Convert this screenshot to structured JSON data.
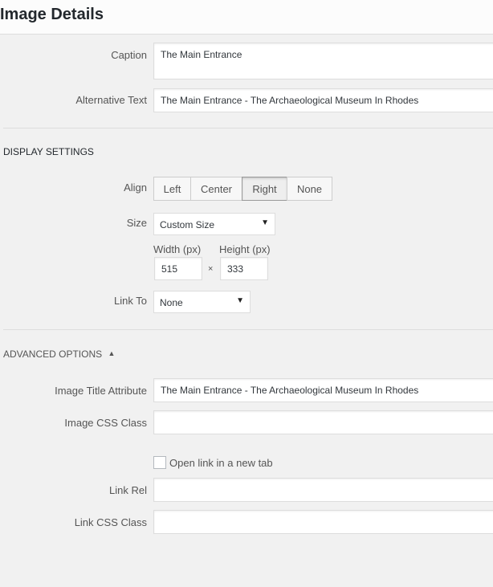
{
  "header": {
    "title": "Image Details"
  },
  "caption": {
    "label": "Caption",
    "value": "The Main Entrance"
  },
  "alt_text": {
    "label": "Alternative Text",
    "value": "The Main Entrance - The Archaeological Museum In Rhodes"
  },
  "display_settings": {
    "title": "DISPLAY SETTINGS",
    "align": {
      "label": "Align",
      "options": [
        "Left",
        "Center",
        "Right",
        "None"
      ],
      "selected": "Right"
    },
    "size": {
      "label": "Size",
      "value": "Custom Size"
    },
    "width": {
      "label": "Width (px)",
      "value": "515"
    },
    "height": {
      "label": "Height (px)",
      "value": "333"
    },
    "times": "×",
    "link_to": {
      "label": "Link To",
      "value": "None"
    }
  },
  "advanced": {
    "title": "ADVANCED OPTIONS",
    "toggle_arrow": "▲",
    "title_attr": {
      "label": "Image Title Attribute",
      "value": "The Main Entrance - The Archaeological Museum In Rhodes"
    },
    "css_class": {
      "label": "Image CSS Class",
      "value": ""
    },
    "new_tab": {
      "label": "Open link in a new tab",
      "checked": false
    },
    "link_rel": {
      "label": "Link Rel",
      "value": ""
    },
    "link_css": {
      "label": "Link CSS Class",
      "value": ""
    }
  },
  "icons": {
    "dropdown": "▼"
  }
}
